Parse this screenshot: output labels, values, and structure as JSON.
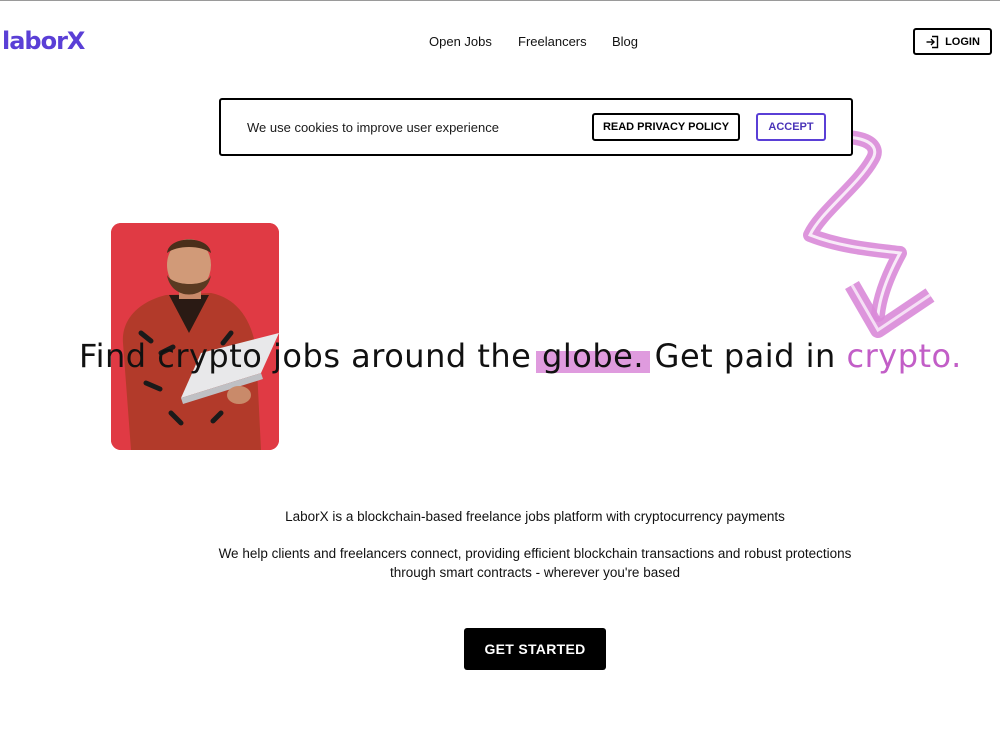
{
  "brand": {
    "logo_text": "laborX",
    "accent_color": "#5a3fd6",
    "highlight_color": "#d98ad8",
    "crypto_color": "#c25ec7"
  },
  "nav": {
    "items": [
      {
        "label": "Open Jobs"
      },
      {
        "label": "Freelancers"
      },
      {
        "label": "Blog"
      }
    ],
    "login_label": "LOGIN",
    "login_icon": "login-icon"
  },
  "cookie_banner": {
    "text": "We use cookies to improve user experience",
    "privacy_label": "READ PRIVACY POLICY",
    "accept_label": "ACCEPT"
  },
  "hero": {
    "headline_part1": "Find crypto jobs around the ",
    "headline_globe": "globe.",
    "headline_part2": " Get paid in ",
    "headline_crypto": "crypto."
  },
  "description": {
    "line1": "LaborX is a blockchain-based freelance jobs platform with cryptocurrency payments",
    "line2": "We help clients and freelancers connect, providing efficient blockchain transactions and robust protections through smart contracts - wherever you're based"
  },
  "cta": {
    "label": "GET STARTED"
  }
}
